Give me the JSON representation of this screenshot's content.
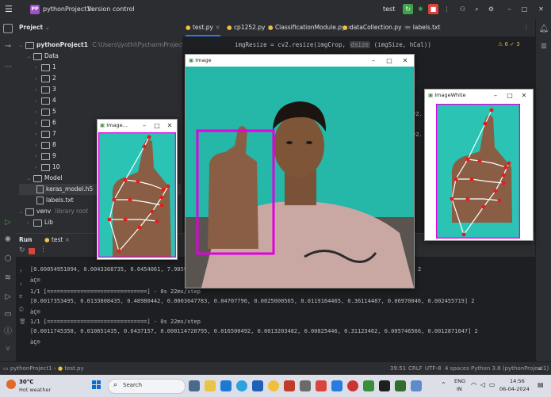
{
  "titlebar": {
    "project_badge": "PP",
    "project_name": "pythonProject1",
    "vcs": "Version control",
    "run_config": "test"
  },
  "project_panel": {
    "title": "Project",
    "root_name": "pythonProject1",
    "root_path": "C:\\Users\\jyothi\\PycharmProjects\\pythonProjec",
    "data_folder": "Data",
    "subfolders": [
      "1",
      "2",
      "3",
      "4",
      "5",
      "6",
      "7",
      "8",
      "9",
      "10"
    ],
    "model_folder": "Model",
    "model_files": [
      "keras_model.h5",
      "labels.txt"
    ],
    "venv_folder": "venv",
    "venv_note": "library root",
    "lib_folder": "Lib"
  },
  "editor": {
    "tabs": [
      "test.py",
      "cp1252.py",
      "ClassificationModule.py",
      "dataCollection.py",
      "labels.txt"
    ],
    "code_line_1_a": "imgResize = cv2.resize(imgCrop, ",
    "code_line_1_hint": "dsize",
    "code_line_1_b": "(imgSize, hCal))",
    "inspection": "⚠ 6  ✓ 3"
  },
  "run_panel": {
    "tab_run": "Run",
    "tab_name": "test",
    "lines": [
      "[0.00054951094, 0.0043368735, 0.6454061, 7.9859674e-05, ...",
      "àÇ®",
      "1/1 [==============================] - 0s 22ms/step",
      "[0.0017353495, 0.0133808435, 0.48980442, 0.0003647783, 0.04707796, 0.0025000565, 0.0119164465, 0.36114487, 0.06970046, 0.002455719] 2",
      "àÇ®",
      "1/1 [==============================] - 0s 22ms/step",
      "[0.0011745358, 0.010651435, 0.6437157, 0.000114720795, 0.016500492, 0.0013203482, 0.00825446, 0.31123462, 0.005746566, 0.0012871647] 2",
      "àÇ®"
    ],
    "right_digit_1": "2"
  },
  "statusbar": {
    "crumb_1": "pythonProject1",
    "crumb_2": "test.py",
    "position": "39:51",
    "line_sep": "CRLF",
    "encoding": "UTF-8",
    "indent": "4 spaces",
    "interpreter": "Python 3.8 (pythonProject1)"
  },
  "windows": {
    "image_title": "Image",
    "imagewhite_title": "ImageWhite",
    "imagecrop_title": "Image..."
  },
  "taskbar": {
    "temp": "30°C",
    "weather": "Hot weather",
    "search": "Search",
    "lang_1": "ENG",
    "lang_2": "IN",
    "time": "14:56",
    "date": "06-04-2024"
  },
  "colors": {
    "accent_magenta": "#e000e0",
    "teal_bg": "#2ac3b4",
    "landmark_red": "#e02020"
  }
}
